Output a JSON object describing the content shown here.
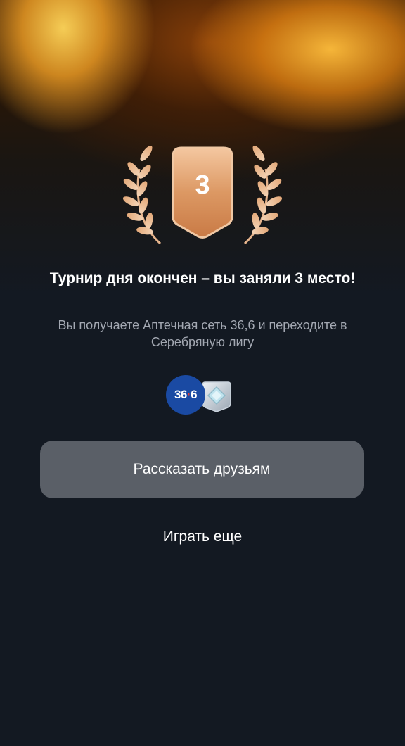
{
  "result": {
    "place": "3",
    "title": "Турнир дня окончен – вы заняли 3 место!",
    "subtitle": "Вы получаете Аптечная сеть 36,6 и переходите в Серебряную лигу"
  },
  "rewards": {
    "pharmacy_logo_text_a": "36",
    "pharmacy_logo_text_sep": "·",
    "pharmacy_logo_text_b": "6",
    "league_icon": "silver-league-icon"
  },
  "actions": {
    "share_label": "Рассказать друзьям",
    "play_again_label": "Играть еще"
  },
  "colors": {
    "background": "#131922",
    "accent_bronze": "#d9945f",
    "button_bg": "#5a5f67"
  }
}
